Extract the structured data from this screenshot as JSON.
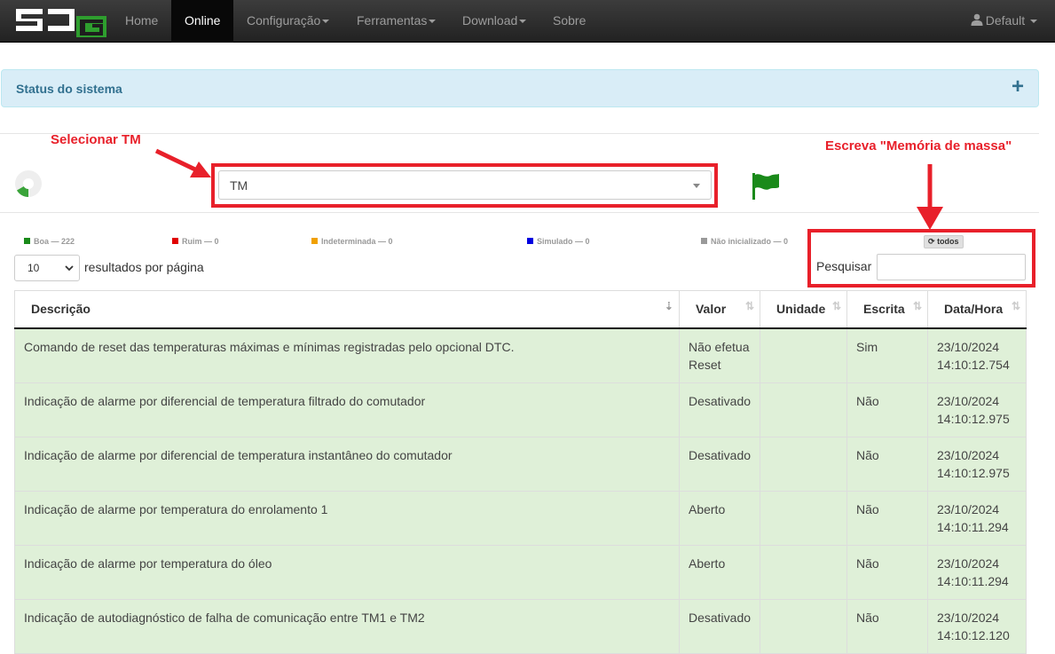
{
  "nav": {
    "items": [
      {
        "label": "Home",
        "dropdown": false,
        "active": false
      },
      {
        "label": "Online",
        "dropdown": false,
        "active": true
      },
      {
        "label": "Configuração",
        "dropdown": true,
        "active": false
      },
      {
        "label": "Ferramentas",
        "dropdown": true,
        "active": false
      },
      {
        "label": "Download",
        "dropdown": true,
        "active": false
      },
      {
        "label": "Sobre",
        "dropdown": false,
        "active": false
      }
    ],
    "user": "Default"
  },
  "panel": {
    "title": "Status do sistema"
  },
  "annotations": {
    "select_tm": "Selecionar TM",
    "write_search": "Escreva \"Memória de massa\""
  },
  "selector": {
    "value": "TM"
  },
  "legend": [
    {
      "label": "Boa — 222",
      "color": "#1a8a1a"
    },
    {
      "label": "Ruim — 0",
      "color": "#e00000"
    },
    {
      "label": "Indeterminada — 0",
      "color": "#f0a000"
    },
    {
      "label": "Simulado — 0",
      "color": "#0000e0"
    },
    {
      "label": "Não inicializado — 0",
      "color": "#999999"
    }
  ],
  "todos_label": "todos",
  "length": {
    "value": "10",
    "label": "resultados por página"
  },
  "search": {
    "label": "Pesquisar",
    "value": ""
  },
  "table": {
    "columns": [
      "Descrição",
      "Valor",
      "Unidade",
      "Escrita",
      "Data/Hora"
    ],
    "rows": [
      {
        "descricao": "Comando de reset das temperaturas máximas e mínimas registradas pelo opcional DTC.",
        "valor": "Não efetua Reset",
        "unidade": "",
        "escrita": "Sim",
        "data": "23/10/2024",
        "hora": "14:10:12.754"
      },
      {
        "descricao": "Indicação de alarme por diferencial de temperatura filtrado do comutador",
        "valor": "Desativado",
        "unidade": "",
        "escrita": "Não",
        "data": "23/10/2024",
        "hora": "14:10:12.975"
      },
      {
        "descricao": "Indicação de alarme por diferencial de temperatura instantâneo do comutador",
        "valor": "Desativado",
        "unidade": "",
        "escrita": "Não",
        "data": "23/10/2024",
        "hora": "14:10:12.975"
      },
      {
        "descricao": "Indicação de alarme por temperatura do enrolamento 1",
        "valor": "Aberto",
        "unidade": "",
        "escrita": "Não",
        "data": "23/10/2024",
        "hora": "14:10:11.294"
      },
      {
        "descricao": "Indicação de alarme por temperatura do óleo",
        "valor": "Aberto",
        "unidade": "",
        "escrita": "Não",
        "data": "23/10/2024",
        "hora": "14:10:11.294"
      },
      {
        "descricao": "Indicação de autodiagnóstico de falha de comunicação entre TM1 e TM2",
        "valor": "Desativado",
        "unidade": "",
        "escrita": "Não",
        "data": "23/10/2024",
        "hora": "14:10:12.120"
      }
    ]
  },
  "colors": {
    "row_good": "#dff0d8",
    "annotation": "#e8202a",
    "flag": "#1a8a1a",
    "panel_text": "#31708f"
  }
}
